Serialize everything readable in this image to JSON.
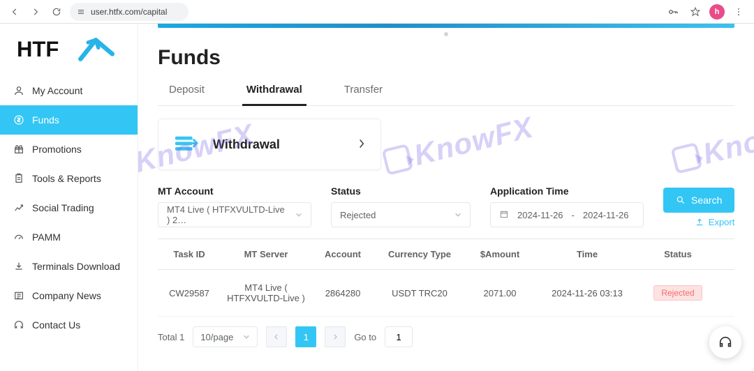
{
  "browser": {
    "url_host": "user.htfx.com/capital",
    "avatar_letter": "h"
  },
  "brand": "HTFX",
  "sidebar": {
    "items": [
      {
        "label": "My Account"
      },
      {
        "label": "Funds"
      },
      {
        "label": "Promotions"
      },
      {
        "label": "Tools & Reports"
      },
      {
        "label": "Social Trading"
      },
      {
        "label": "PAMM"
      },
      {
        "label": "Terminals Download"
      },
      {
        "label": "Company News"
      },
      {
        "label": "Contact Us"
      }
    ]
  },
  "page": {
    "title": "Funds",
    "tabs": {
      "deposit": "Deposit",
      "withdrawal": "Withdrawal",
      "transfer": "Transfer"
    },
    "card_label": "Withdrawal"
  },
  "filters": {
    "mt_label": "MT Account",
    "mt_value": "MT4 Live ( HTFXVULTD-Live ) 2…",
    "status_label": "Status",
    "status_value": "Rejected",
    "time_label": "Application Time",
    "date_from": "2024-11-26",
    "date_sep": "-",
    "date_to": "2024-11-26",
    "search_btn": "Search",
    "export_btn": "Export"
  },
  "table": {
    "headers": {
      "task": "Task ID",
      "server": "MT Server",
      "account": "Account",
      "currency": "Currency Type",
      "amount": "$Amount",
      "time": "Time",
      "status": "Status"
    },
    "rows": [
      {
        "task": "CW29587",
        "server": "MT4 Live ( HTFXVULTD-Live )",
        "account": "2864280",
        "currency": "USDT TRC20",
        "amount": "2071.00",
        "time": "2024-11-26 03:13",
        "status": "Rejected"
      }
    ]
  },
  "pager": {
    "total_label": "Total 1",
    "page_size": "10/page",
    "current": "1",
    "goto_label": "Go to",
    "goto_value": "1"
  },
  "watermark": "KnowFX"
}
